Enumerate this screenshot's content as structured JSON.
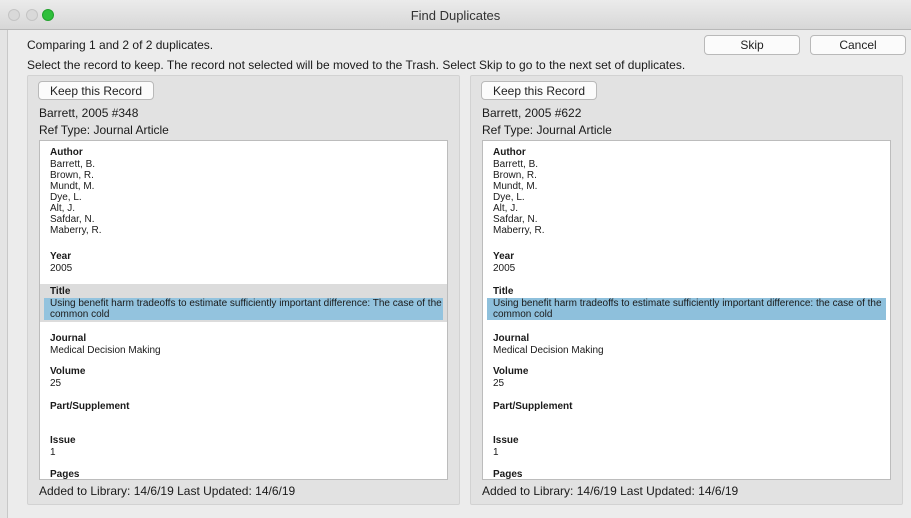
{
  "window": {
    "title": "Find Duplicates"
  },
  "status": "Comparing 1 and 2 of 2 duplicates.",
  "instruction": "Select the record to keep. The record not selected will be moved to the Trash. Select Skip to go to the next set of duplicates.",
  "buttons": {
    "skip": "Skip",
    "cancel": "Cancel"
  },
  "labels": {
    "author": "Author",
    "year": "Year",
    "title": "Title",
    "journal": "Journal",
    "volume": "Volume",
    "part": "Part/Supplement",
    "issue": "Issue",
    "pages": "Pages"
  },
  "records": [
    {
      "keep_label": "Keep this Record",
      "id": "Barrett, 2005 #348",
      "ref_type": "Ref Type:  Journal Article",
      "authors": [
        "Barrett, B.",
        "Brown, R.",
        "Mundt, M.",
        "Dye, L.",
        "Alt, J.",
        "Safdar, N.",
        "Maberry, R."
      ],
      "year": "2005",
      "title": "Using benefit harm tradeoffs to estimate sufficiently important difference: The case of the common cold",
      "journal": "Medical Decision Making",
      "volume": "25",
      "part": "",
      "issue": "1",
      "footer": "Added to Library: 14/6/19    Last Updated: 14/6/19"
    },
    {
      "keep_label": "Keep this Record",
      "id": "Barrett, 2005 #622",
      "ref_type": "Ref Type:  Journal Article",
      "authors": [
        "Barrett, B.",
        "Brown, R.",
        "Mundt, M.",
        "Dye, L.",
        "Alt, J.",
        "Safdar, N.",
        "Maberry, R."
      ],
      "year": "2005",
      "title": "Using benefit harm tradeoffs to estimate sufficiently important difference: the case of the common cold",
      "journal": "Medical Decision Making",
      "volume": "25",
      "part": "",
      "issue": "1",
      "footer": "Added to Library: 14/6/19    Last Updated: 14/6/19"
    }
  ]
}
